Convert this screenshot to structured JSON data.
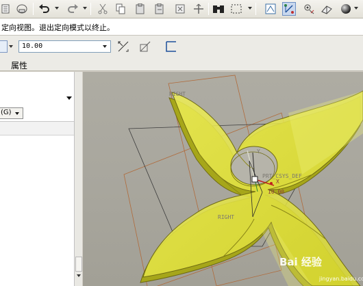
{
  "toolbar": {
    "buttons": [
      {
        "name": "view-tree-icon"
      },
      {
        "name": "undo-icon"
      },
      {
        "name": "redo-icon"
      },
      {
        "name": "cut-icon"
      },
      {
        "name": "copy-icon"
      },
      {
        "name": "paste-icon"
      },
      {
        "name": "paste-special-icon"
      },
      {
        "name": "regenerate-icon"
      },
      {
        "name": "find-icon"
      },
      {
        "name": "select-box-icon"
      },
      {
        "name": "datum-plane-icon"
      },
      {
        "name": "datum-axis-icon"
      },
      {
        "name": "datum-point-icon"
      },
      {
        "name": "csys-icon"
      },
      {
        "name": "shaded-sphere-icon"
      },
      {
        "name": "orient-icon"
      }
    ]
  },
  "message_bar": {
    "text": "定向视图。退出定向模式以终止。"
  },
  "dashboard": {
    "offset_value": "10.00",
    "tab_properties": "属性"
  },
  "panel": {
    "select_label": "(G)"
  },
  "viewport": {
    "labels": {
      "right_top": "RIGHT",
      "right_bottom": "RIGHT",
      "csys": "PRT_CSYS_DEF",
      "axis_y": "Y",
      "axis_x": "X",
      "dimension": "10.00"
    }
  },
  "watermark": {
    "main": "Bai 经验",
    "sub": "jingyan.baidu.com"
  }
}
